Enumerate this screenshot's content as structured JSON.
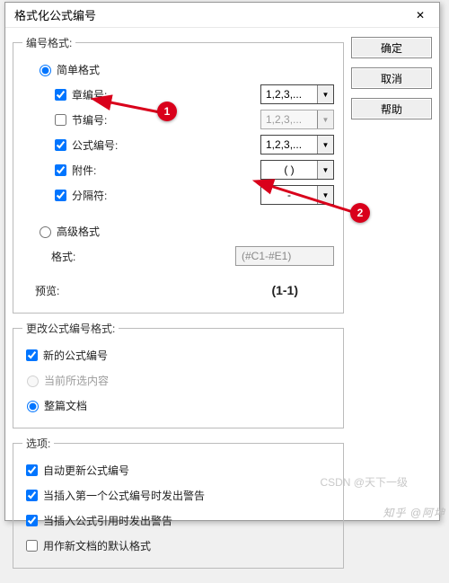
{
  "title": "格式化公式编号",
  "buttons": {
    "ok": "确定",
    "cancel": "取消",
    "help": "帮助"
  },
  "fs1": {
    "legend": "编号格式:",
    "simple": "简单格式",
    "chapter": "章编号:",
    "section": "节编号:",
    "equation": "公式编号:",
    "enclosure": "附件:",
    "separator": "分隔符:",
    "advanced": "高级格式",
    "format_label": "格式:",
    "format_value": "(#C1-#E1)",
    "preview_label": "预览:",
    "preview_value": "(1-1)"
  },
  "combo": {
    "chapter": "1,2,3,...",
    "section": "1,2,3,...",
    "equation": "1,2,3,...",
    "enclosure": "( )",
    "separator": "-"
  },
  "fs2": {
    "legend": "更改公式编号格式:",
    "new_eq": "新的公式编号",
    "current_sel": "当前所选内容",
    "whole_doc": "整篇文档"
  },
  "fs3": {
    "legend": "选项:",
    "auto_update": "自动更新公式编号",
    "warn_first": "当插入第一个公式编号时发出警告",
    "warn_ref": "当插入公式引用时发出警告",
    "default_new": "用作新文档的默认格式"
  },
  "markers": {
    "one": "1",
    "two": "2"
  },
  "wm": "知乎 @阿坤",
  "wm2": "CSDN @天下一级"
}
